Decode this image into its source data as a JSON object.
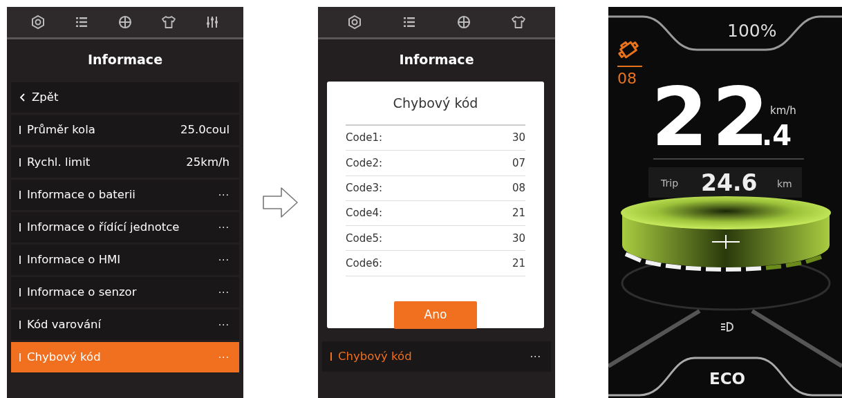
{
  "menu_screen": {
    "kind": "menu",
    "toolbar": [
      {
        "kind": "gear"
      },
      {
        "kind": "list"
      },
      {
        "kind": "globe"
      },
      {
        "kind": "shirt"
      },
      {
        "kind": "sliders"
      }
    ],
    "title": "Informace",
    "back": "Zpět",
    "items": [
      {
        "label": "Průměr kola",
        "value": "25.0coul",
        "selected": false
      },
      {
        "label": "Rychl. limit",
        "value": "25km/h",
        "selected": false
      },
      {
        "label": "Informace o baterii",
        "value": "···",
        "selected": false
      },
      {
        "label": "Informace o řídící jednotce",
        "value": "···",
        "selected": false
      },
      {
        "label": "Informace o HMI",
        "value": "···",
        "selected": false
      },
      {
        "label": "Informace o senzor",
        "value": "···",
        "selected": false
      },
      {
        "label": "Kód varování",
        "value": "···",
        "selected": false
      },
      {
        "label": "Chybový kód",
        "value": "···",
        "selected": true
      }
    ]
  },
  "error_screen": {
    "kind": "popup",
    "toolbar": [
      {
        "kind": "gear"
      },
      {
        "kind": "list"
      },
      {
        "kind": "globe"
      },
      {
        "kind": "shirt"
      }
    ],
    "title": "Informace",
    "items": [
      {
        "label": "Chybový kód",
        "value": "···",
        "selected": true
      }
    ],
    "dialog": {
      "title": "Chybový kód",
      "rows": [
        {
          "label": "Code1:",
          "value": "30"
        },
        {
          "label": "Code2:",
          "value": "07"
        },
        {
          "label": "Code3:",
          "value": "08"
        },
        {
          "label": "Code4:",
          "value": "21"
        },
        {
          "label": "Code5:",
          "value": "30"
        },
        {
          "label": "Code6:",
          "value": "21"
        }
      ],
      "button": "Ano"
    }
  },
  "dashboard": {
    "battery": "100%",
    "error_code": "08",
    "speed": "22",
    "speed_decimal": ".4",
    "speed_unit": "km/h",
    "trip_label": "Trip",
    "trip_value": "24.6",
    "trip_unit": "km",
    "assist": {
      "level": 0.7
    },
    "mode": "ECO"
  }
}
